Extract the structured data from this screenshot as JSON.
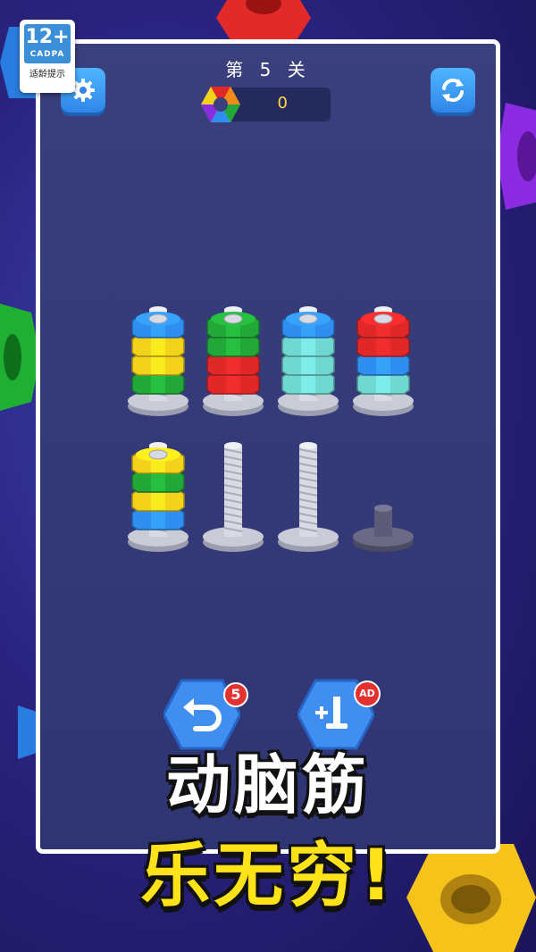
{
  "age_rating": {
    "number": "12+",
    "org": "CADPA",
    "hint": "适龄提示"
  },
  "header": {
    "level_title": "第 5 关",
    "score": "0"
  },
  "buttons": {
    "undo_count": "5",
    "add_screw_badge": "AD"
  },
  "slogan": {
    "line1": "动脑筋",
    "line2": "乐无穷!"
  },
  "colors": {
    "blue": "#2f8ff0",
    "yellow": "#f2d21a",
    "green": "#22a838",
    "red": "#e02828",
    "teal": "#6fd8d0"
  },
  "board": {
    "rows": [
      [
        {
          "nuts": [
            "green",
            "yellow",
            "yellow",
            "blue"
          ]
        },
        {
          "nuts": [
            "red",
            "red",
            "green",
            "green"
          ]
        },
        {
          "nuts": [
            "teal",
            "teal",
            "teal",
            "blue"
          ]
        },
        {
          "nuts": [
            "teal",
            "blue",
            "red",
            "red"
          ]
        }
      ],
      [
        {
          "nuts": [
            "blue",
            "yellow",
            "green",
            "yellow"
          ]
        },
        {
          "nuts": []
        },
        {
          "nuts": []
        },
        {
          "nuts": [],
          "locked": true
        }
      ]
    ]
  }
}
